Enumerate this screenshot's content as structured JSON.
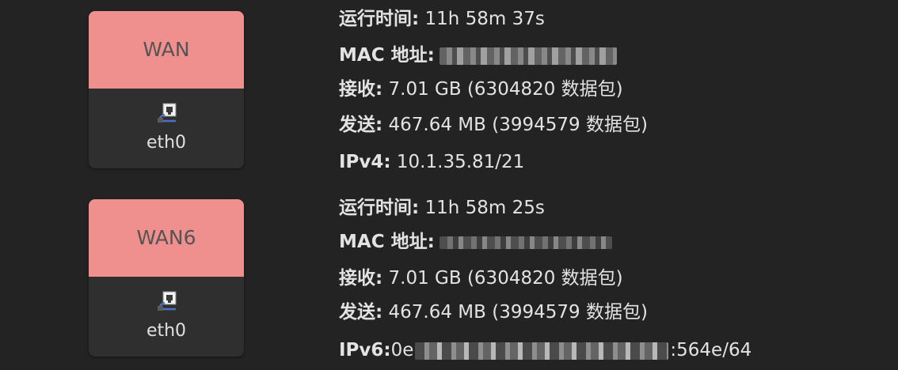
{
  "colors": {
    "background": "#232323",
    "wan_header": "#f0908e",
    "text": "#e3e3e3",
    "card_body": "#2f2f2f"
  },
  "interfaces": [
    {
      "name": "WAN",
      "device": "eth0",
      "device_icon": "ethernet-port-icon",
      "uptime_label": "运行时间:",
      "uptime": " 11h 58m 37s",
      "mac_label": "MAC 地址:",
      "rx_label": "接收:",
      "rx": " 7.01 GB (6304820 数据包)",
      "tx_label": "发送:",
      "tx": " 467.64 MB (3994579 数据包)",
      "ip_label": "IPv4:",
      "ip": " 10.1.35.81/21"
    },
    {
      "name": "WAN6",
      "device": "eth0",
      "device_icon": "ethernet-port-icon",
      "uptime_label": "运行时间:",
      "uptime": " 11h 58m 25s",
      "mac_label": "MAC 地址:",
      "rx_label": "接收:",
      "rx": " 7.01 GB (6304820 数据包)",
      "tx_label": "发送:",
      "tx": " 467.64 MB (3994579 数据包)",
      "ip_label": "IPv6:",
      "ip_prefix": "0e",
      "ip_suffix": ":564e/64"
    }
  ]
}
